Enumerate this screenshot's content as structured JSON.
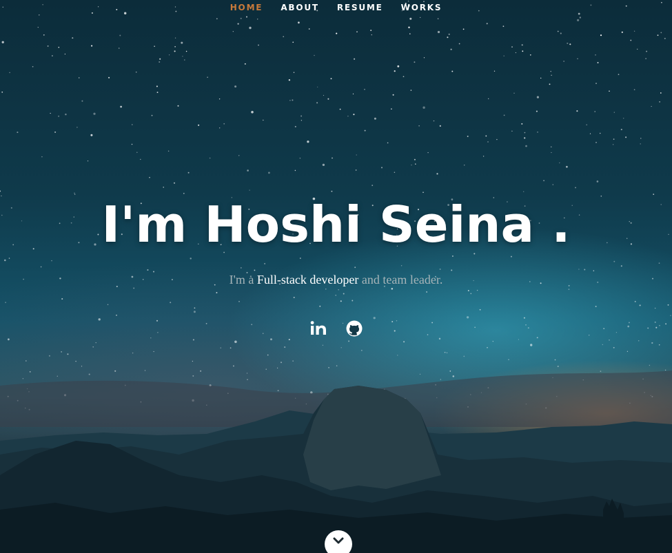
{
  "nav": {
    "items": [
      {
        "label": "HOME",
        "active": true
      },
      {
        "label": "ABOUT",
        "active": false
      },
      {
        "label": "RESUME",
        "active": false
      },
      {
        "label": "WORKS",
        "active": false
      }
    ],
    "active_color": "#c97a3a"
  },
  "hero": {
    "headline": "I'm Hoshi Seina .",
    "tagline": {
      "prefix": "I'm a ",
      "highlight": "Full-stack developer",
      "suffix": " and team leader."
    }
  },
  "social": {
    "icons": [
      "linkedin-icon",
      "github-icon"
    ]
  },
  "scroll_button": {
    "icon": "chevron-down-icon"
  }
}
